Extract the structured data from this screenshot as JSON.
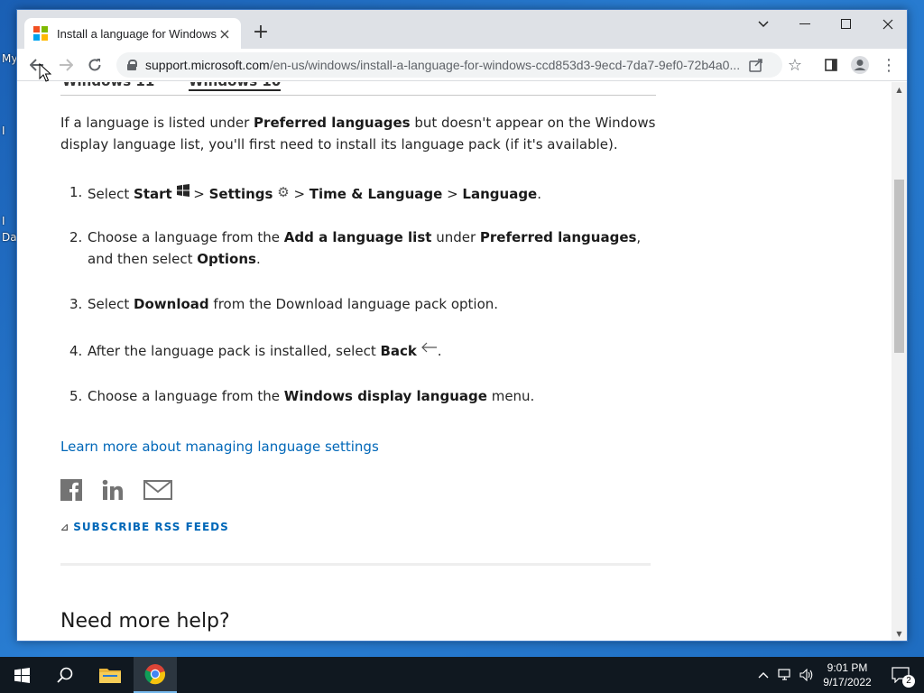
{
  "desktop": {
    "labels": [
      "My",
      "I",
      "I",
      "Da"
    ]
  },
  "browser": {
    "tab_title": "Install a language for Windows",
    "url_host": "support.microsoft.com",
    "url_path": "/en-us/windows/install-a-language-for-windows-ccd853d3-9ecd-7da7-9ef0-72b4a0..."
  },
  "page": {
    "os_tabs": [
      "Windows 11",
      "Windows 10"
    ],
    "intro_pre": "If a language is listed under ",
    "intro_bold": "Preferred languages",
    "intro_post": " but doesn't appear on the Windows display language list, you'll first need to install its language pack (if it's available).",
    "steps": [
      {
        "num": "1.",
        "parts": [
          "Select ",
          "Start",
          " > ",
          "Settings",
          " > ",
          "Time & Language",
          " > ",
          "Language",
          "."
        ]
      },
      {
        "num": "2.",
        "parts": [
          "Choose a language from the ",
          "Add a language list",
          " under ",
          "Preferred languages",
          ", and then select ",
          "Options",
          "."
        ]
      },
      {
        "num": "3.",
        "parts": [
          "Select ",
          "Download",
          " from the Download language pack option."
        ]
      },
      {
        "num": "4.",
        "parts": [
          "After the language pack is installed, select ",
          "Back",
          "."
        ]
      },
      {
        "num": "5.",
        "parts": [
          "Choose a language from the ",
          "Windows display language",
          " menu."
        ]
      }
    ],
    "learn_more": "Learn more about managing language settings",
    "rss": "SUBSCRIBE RSS FEEDS",
    "need_help": "Need more help?"
  },
  "taskbar": {
    "time": "9:01 PM",
    "date": "9/17/2022",
    "notification_count": "2"
  },
  "colors": {
    "link": "#0067b8",
    "taskbar": "#101820",
    "chrome_frame": "#dee1e6"
  }
}
